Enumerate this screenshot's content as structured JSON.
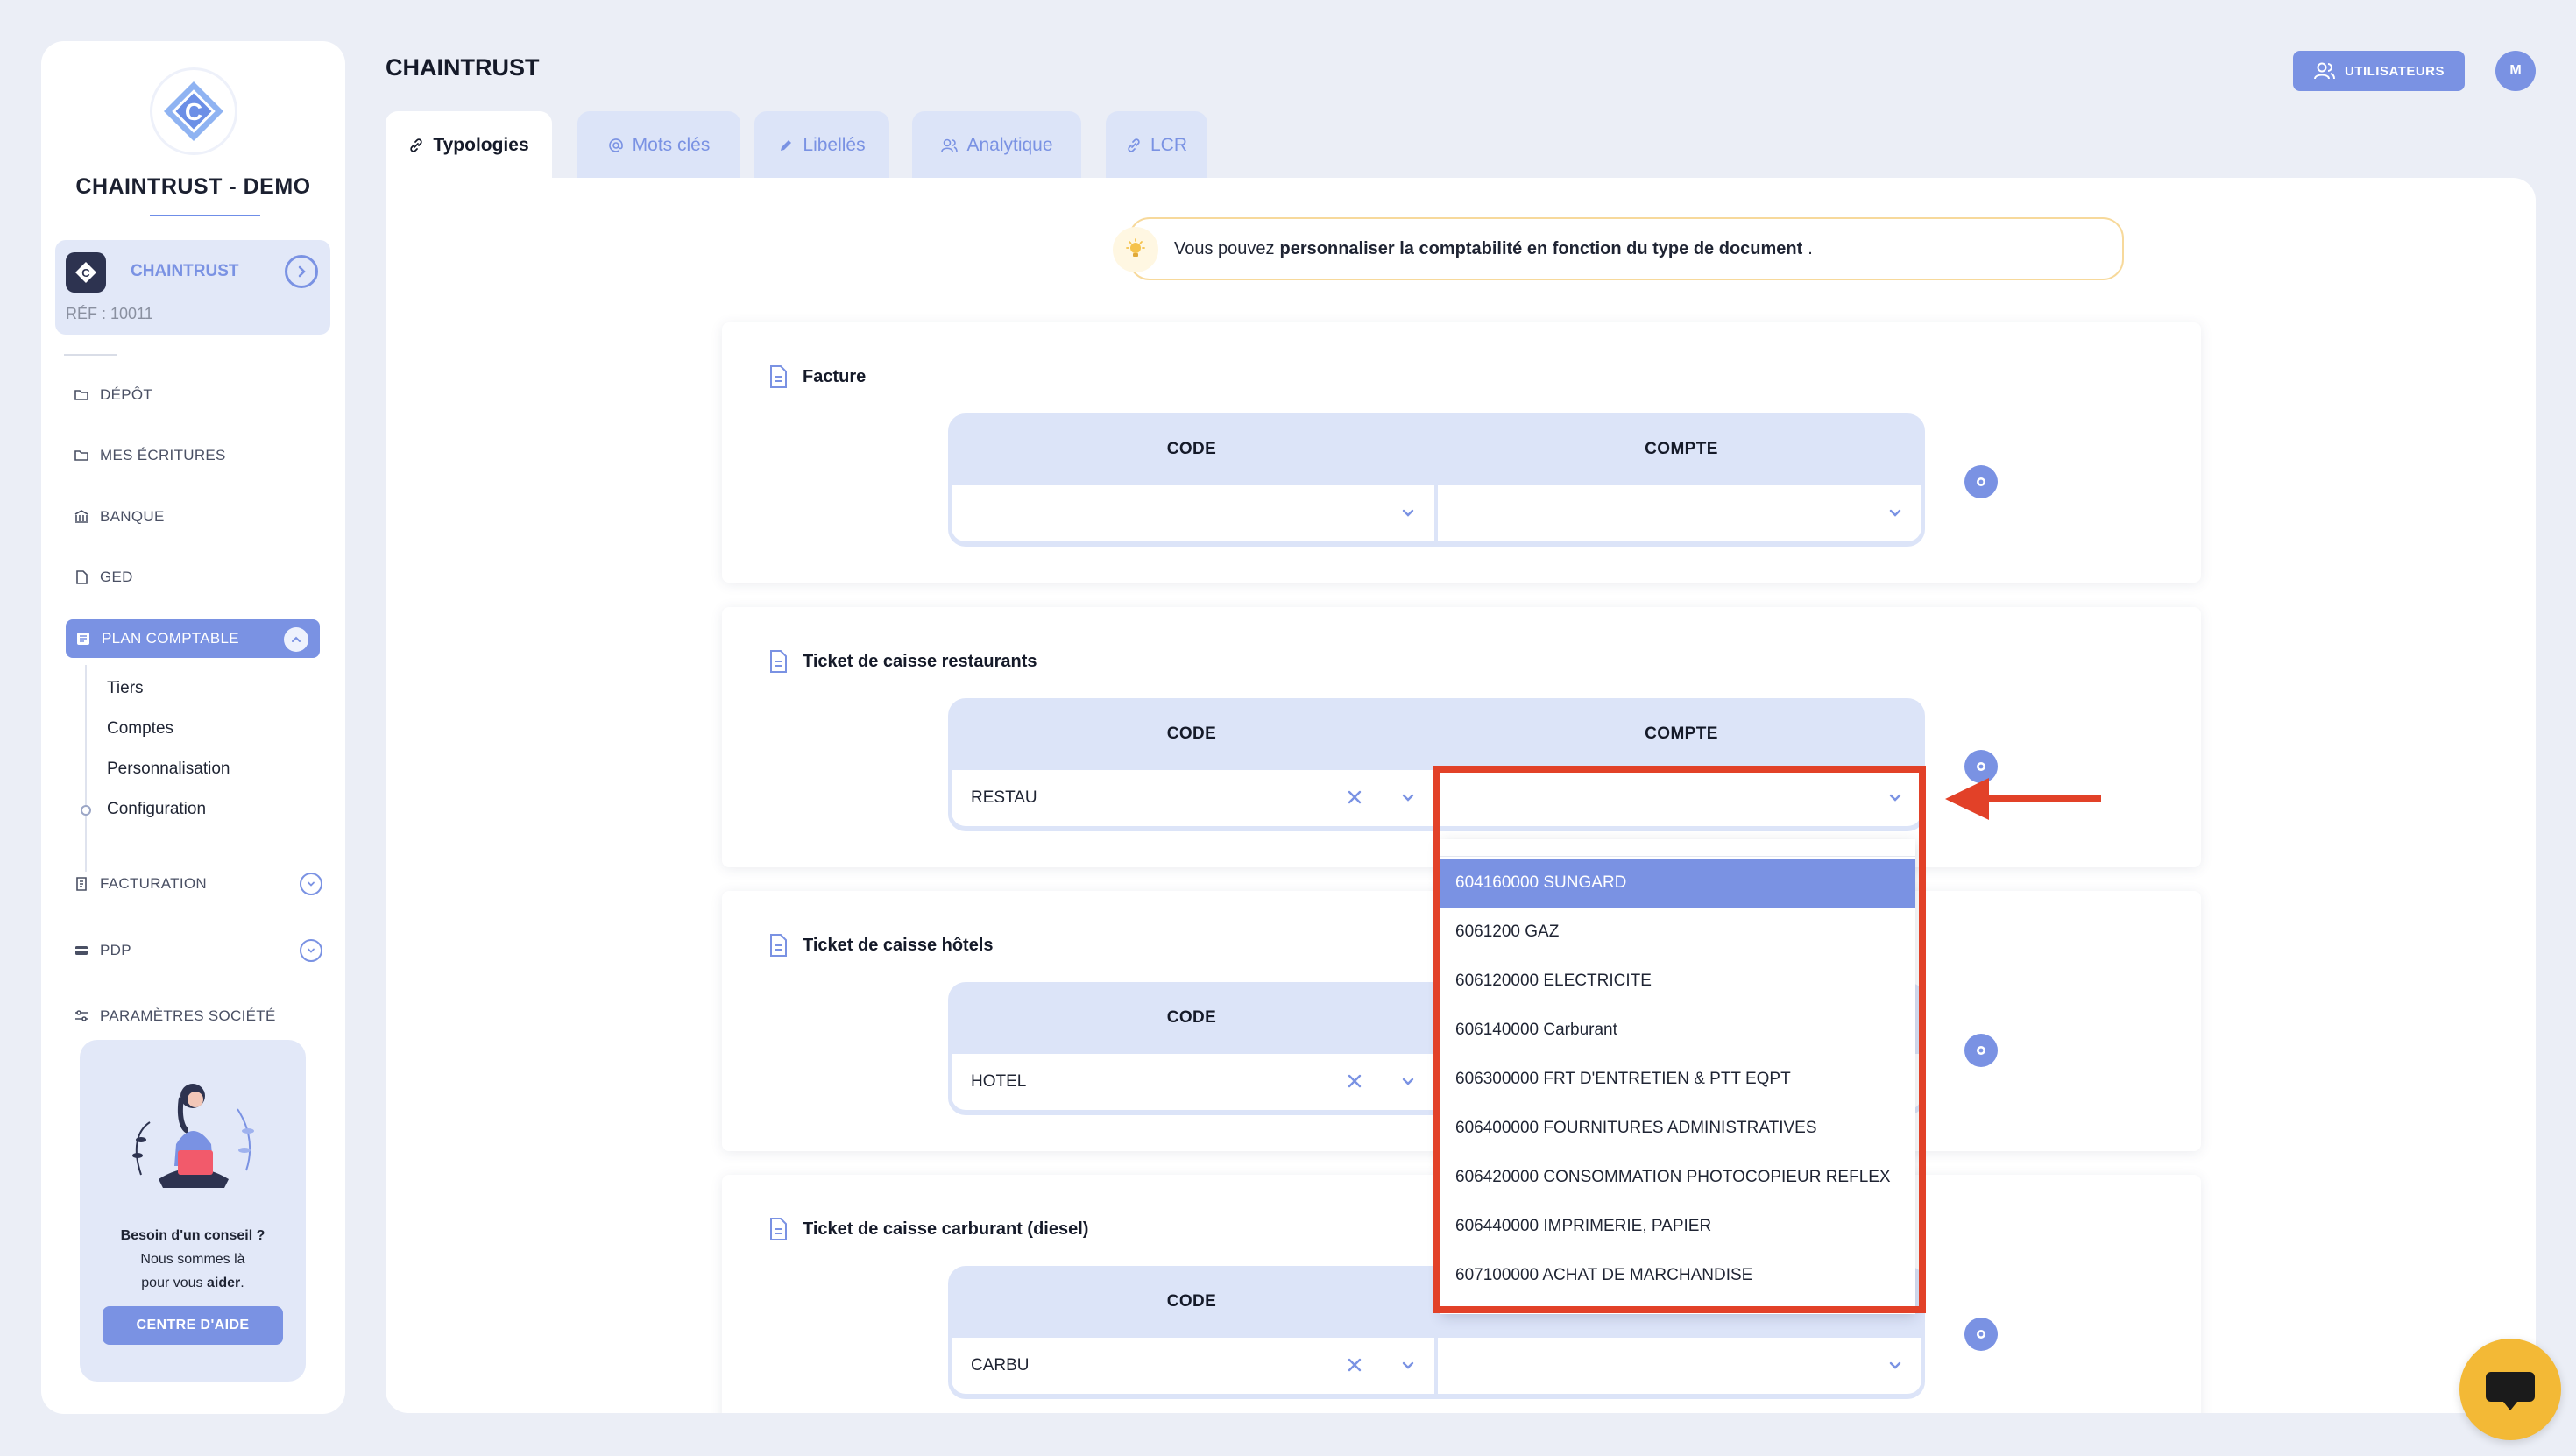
{
  "company": {
    "title": "CHAINTRUST - DEMO",
    "org_name": "CHAINTRUST",
    "ref": "RÉF : 10011"
  },
  "nav": {
    "depot": "DÉPÔT",
    "ecritures": "MES ÉCRITURES",
    "banque": "BANQUE",
    "ged": "GED",
    "plan_comptable": "PLAN COMPTABLE",
    "sub": [
      "Tiers",
      "Comptes",
      "Personnalisation",
      "Configuration"
    ],
    "facturation": "FACTURATION",
    "pdp": "PDP",
    "parametres": "PARAMÈTRES SOCIÉTÉ"
  },
  "help": {
    "line1": "Besoin d'un conseil ?",
    "line2": "Nous sommes là",
    "line3_pre": "pour vous ",
    "line3_bold": "aider",
    "line3_post": ".",
    "button": "CENTRE D'AIDE"
  },
  "header": {
    "title": "CHAINTRUST",
    "users_button": "UTILISATEURS",
    "avatar": "M"
  },
  "tabs": [
    "Typologies",
    "Mots clés",
    "Libellés",
    "Analytique",
    "LCR"
  ],
  "info": {
    "pre": "Vous pouvez",
    "bold": "personnaliser la comptabilité en fonction du type de document",
    "post": "."
  },
  "table_headers": {
    "code": "CODE",
    "compte": "COMPTE"
  },
  "sections": [
    {
      "title": "Facture",
      "code": "",
      "compte": ""
    },
    {
      "title": "Ticket de caisse restaurants",
      "code": "RESTAU",
      "compte": ""
    },
    {
      "title": "Ticket de caisse hôtels",
      "code": "HOTEL",
      "compte": ""
    },
    {
      "title": "Ticket de caisse carburant (diesel)",
      "code": "CARBU",
      "compte": ""
    }
  ],
  "dropdown": {
    "options": [
      "604160000 SUNGARD",
      "6061200 GAZ",
      "606120000 ELECTRICITE",
      "606140000 Carburant",
      "606300000 FRT D'ENTRETIEN & PTT EQPT",
      "606400000 FOURNITURES ADMINISTRATIVES",
      "606420000 CONSOMMATION PHOTOCOPIEUR REFLEX",
      "606440000 IMPRIMERIE, PAPIER",
      "607100000 ACHAT DE MARCHANDISE"
    ],
    "selected_index": 0
  },
  "colors": {
    "accent": "#7a92e3",
    "highlight": "#e24128",
    "chat": "#f3b936"
  }
}
